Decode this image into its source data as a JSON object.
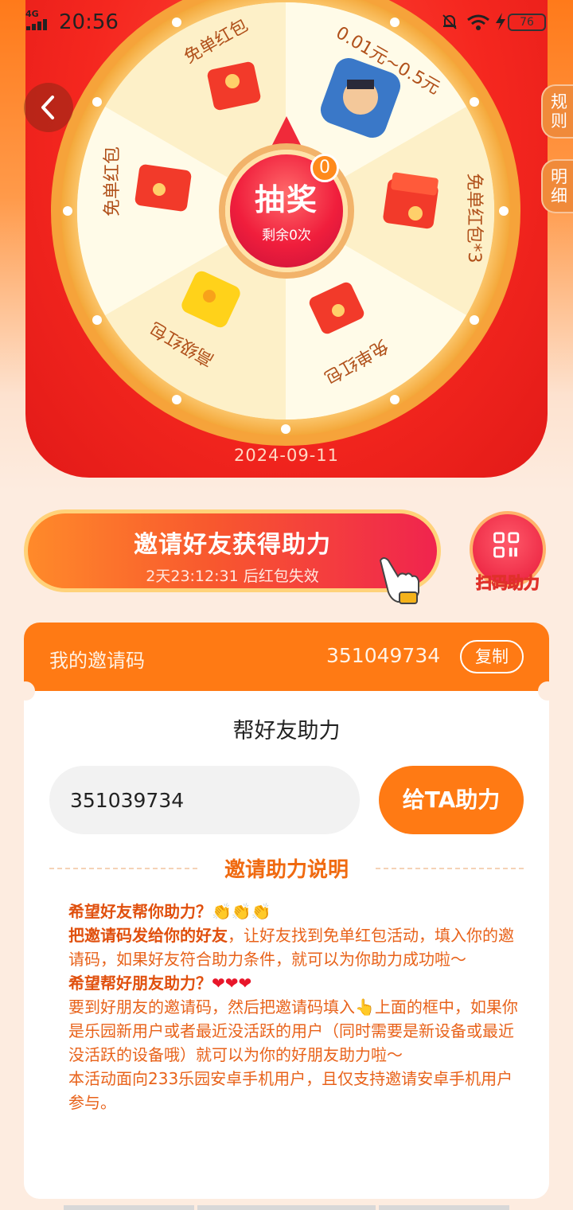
{
  "status_bar": {
    "network": "4G",
    "time": "20:56",
    "battery": "76"
  },
  "nav": {
    "rules_label": "规则",
    "detail_label": "明细"
  },
  "wheel": {
    "segments": [
      "免单红包",
      "0.01元~0.5元",
      "免单红包*3",
      "免单红包",
      "高级红包",
      "免单红包"
    ],
    "draw_button": "抽奖",
    "remaining": "剩余0次",
    "badge_count": "0",
    "date": "2024-09-11"
  },
  "invite": {
    "button_label": "邀请好友获得助力",
    "countdown": "2天23:12:31 后红包失效",
    "scan_label": "扫码助力"
  },
  "code_card": {
    "label": "我的邀请码",
    "code": "351049734",
    "copy_label": "复制"
  },
  "help": {
    "title": "帮好友助力",
    "input_value": "351039734",
    "button_label": "给TA助力"
  },
  "rules": {
    "title": "邀请助力说明",
    "q1": "希望好友帮你助力？",
    "p1_bold": "把邀请码发给你的好友",
    "p1_rest": "，让好友找到免单红包活动，填入你的邀请码，如果好友符合助力条件，就可以为你助力成功啦～",
    "q2": "希望帮好朋友助力？",
    "p2_a": "要到好朋友的邀请码，然后把邀请码填入",
    "p2_b": "上面的框中，如果你是乐园新用户或者最近没活跃的用户（同时需要是新设备或最近没活跃的设备哦）就可以为你的好朋友助力啦～",
    "p3": "本活动面向233乐园安卓手机用户，且仅支持邀请安卓手机用户参与。"
  },
  "colors": {
    "accent": "#ff7a14",
    "wheel_red": "#f5271f",
    "rules_text": "#e8621a"
  }
}
